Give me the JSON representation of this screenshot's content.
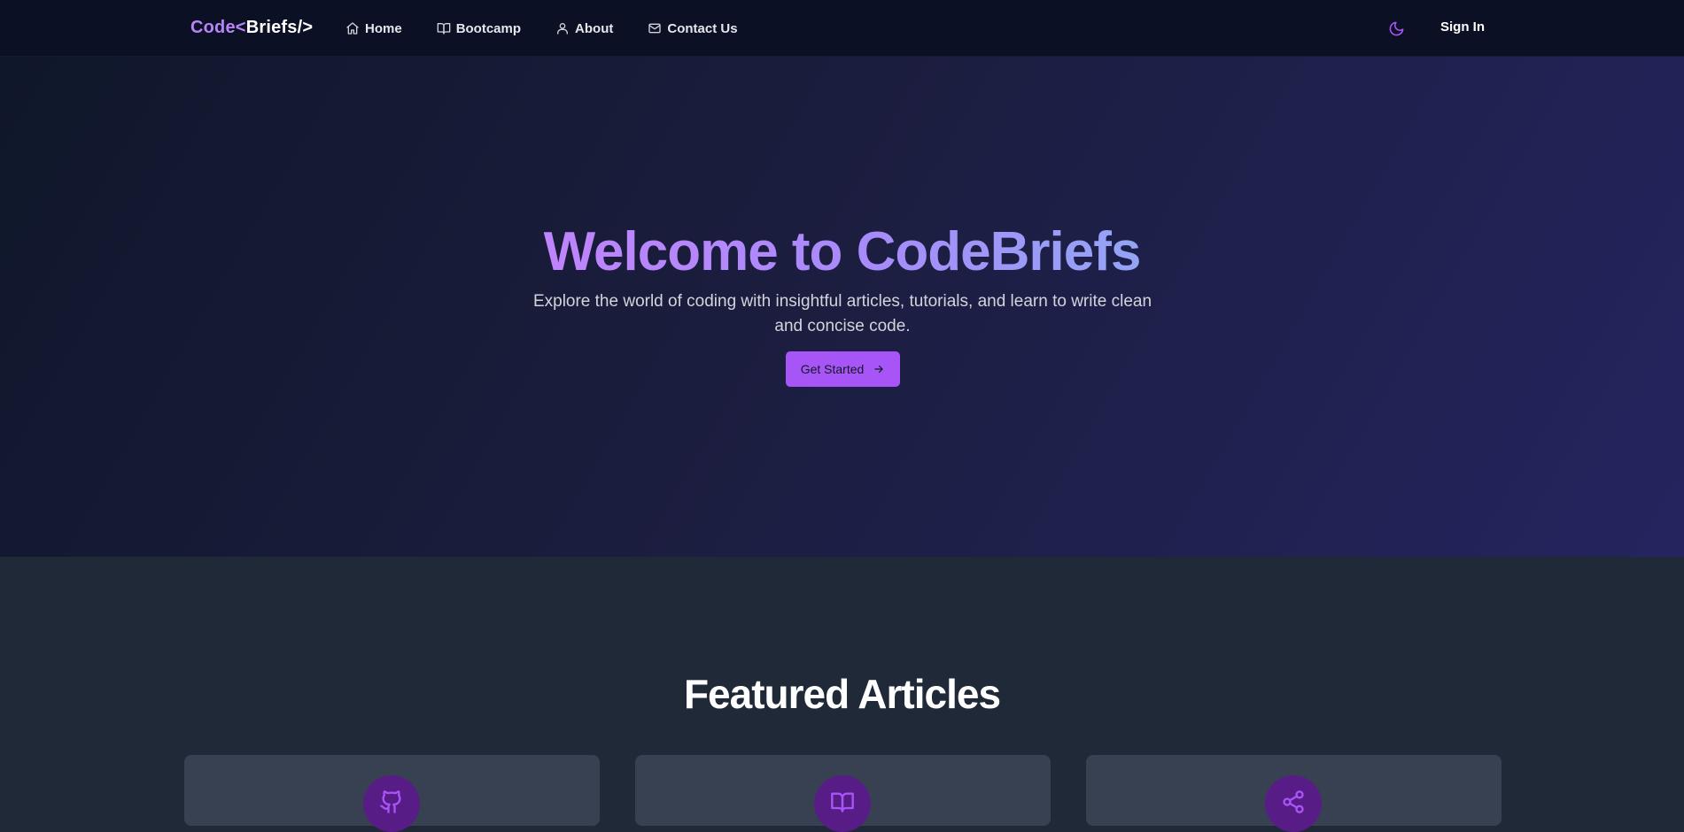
{
  "brand": {
    "part1": "Code<",
    "part2": "Briefs/>"
  },
  "nav": {
    "items": [
      {
        "label": "Home",
        "icon": "home-icon"
      },
      {
        "label": "Bootcamp",
        "icon": "book-open-icon"
      },
      {
        "label": "About",
        "icon": "user-icon"
      },
      {
        "label": "Contact Us",
        "icon": "mail-icon"
      }
    ],
    "theme_icon": "moon-icon",
    "signin_label": "Sign In"
  },
  "hero": {
    "title": "Welcome to CodeBriefs",
    "subtitle": "Explore the world of coding with insightful articles, tutorials, and learn to write clean and concise code.",
    "cta_label": "Get Started",
    "cta_icon": "arrow-right-icon"
  },
  "featured": {
    "title": "Featured Articles",
    "cards": [
      {
        "icon": "github-icon"
      },
      {
        "icon": "book-open-icon"
      },
      {
        "icon": "share-icon"
      }
    ]
  },
  "colors": {
    "accent": "#a855f7",
    "navbar_bg": "#0b1024",
    "page_bg": "#1f2937",
    "card_bg": "#374151",
    "icon_circle": "#581c87"
  }
}
